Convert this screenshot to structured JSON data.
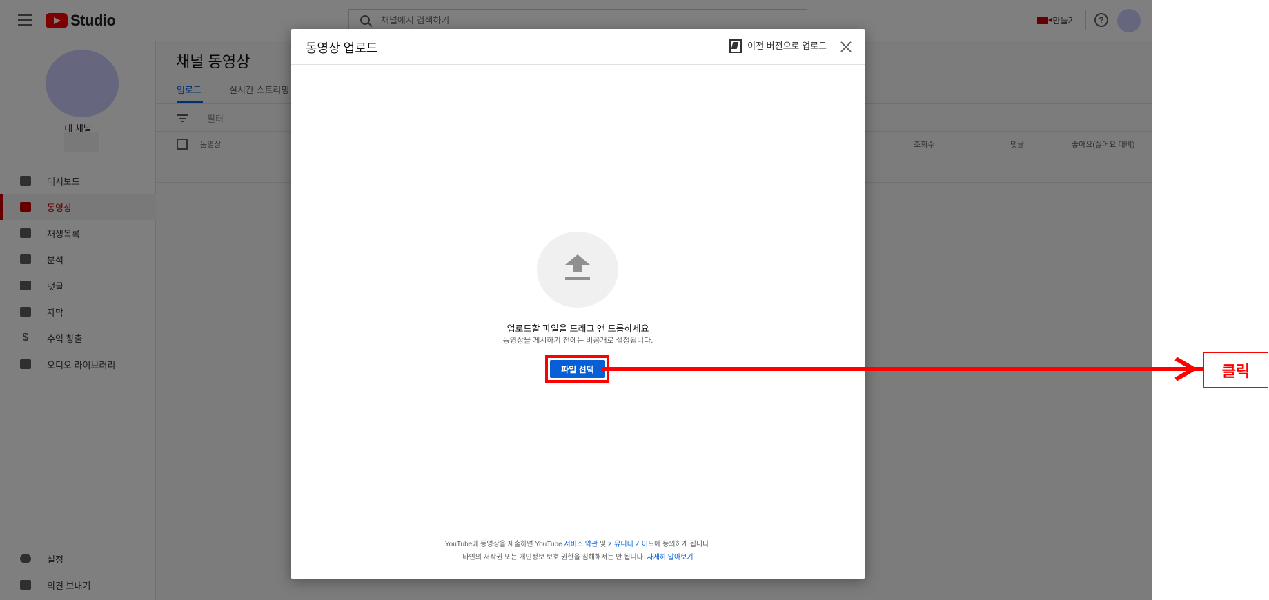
{
  "topbar": {
    "logo_text": "Studio",
    "search_placeholder": "채널에서 검색하기",
    "create_label": "만들기"
  },
  "sidebar": {
    "channel_name": "내 채널",
    "items": [
      {
        "label": "대시보드",
        "icon": "dashboard-icon"
      },
      {
        "label": "동영상",
        "icon": "video-icon",
        "active": true
      },
      {
        "label": "재생목록",
        "icon": "playlist-icon"
      },
      {
        "label": "분석",
        "icon": "analytics-icon"
      },
      {
        "label": "댓글",
        "icon": "comment-icon"
      },
      {
        "label": "자막",
        "icon": "subtitles-icon"
      },
      {
        "label": "수익 창출",
        "icon": "dollar-icon"
      },
      {
        "label": "오디오 라이브러리",
        "icon": "audio-library-icon"
      }
    ],
    "bottom_items": [
      {
        "label": "설정",
        "icon": "gear-icon"
      },
      {
        "label": "의견 보내기",
        "icon": "feedback-icon"
      }
    ]
  },
  "main": {
    "title": "채널 동영상",
    "tabs": [
      {
        "label": "업로드",
        "active": true
      },
      {
        "label": "실시간 스트리밍"
      }
    ],
    "filter_label": "필터",
    "columns": [
      "동영상",
      "조회수",
      "댓글",
      "좋아요(싫어요 대비)"
    ]
  },
  "dialog": {
    "title": "동영상 업로드",
    "legacy_label": "이전 버전으로 업로드",
    "drop_title": "업로드할 파일을 드래그 앤 드롭하세요",
    "drop_subtitle": "동영상을 게시하기 전에는 비공개로 설정됩니다.",
    "select_button": "파일 선택",
    "terms_line1_a": "YouTube에 동영상을 제출하면 YouTube ",
    "terms_link_tos": "서비스 약관",
    "terms_line1_b": " 및 ",
    "terms_link_guidelines": "커뮤니티 가이드",
    "terms_line1_c": "에 동의하게 됩니다.",
    "terms_line2_a": "타인의 저작권 또는 개인정보 보호 권한을 침해해서는 안 됩니다. ",
    "terms_link_learn": "자세히 알아보기"
  },
  "annotation": {
    "label": "클릭",
    "color": "#ff0000"
  },
  "colors": {
    "accent": "#065fd4",
    "brand": "#ff0000",
    "active_nav": "#cc0000"
  }
}
